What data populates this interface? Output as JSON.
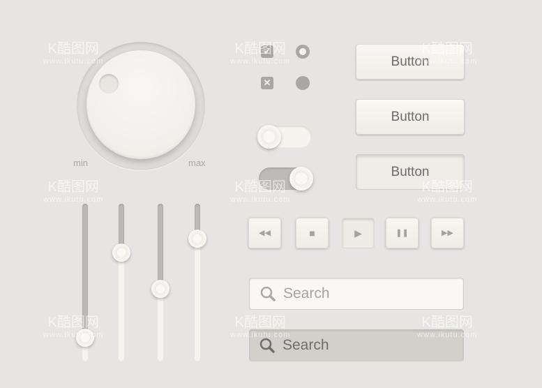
{
  "knob": {
    "min_label": "min",
    "max_label": "max"
  },
  "sliders": [
    {
      "value": 0.15
    },
    {
      "value": 0.69
    },
    {
      "value": 0.46
    },
    {
      "value": 0.78
    }
  ],
  "checkboxes": [
    {
      "state": "checked",
      "icon": "check-icon"
    },
    {
      "state": "unchecked",
      "icon": "x-icon",
      "glyph": "✕"
    }
  ],
  "radios": [
    {
      "selected": true
    },
    {
      "selected": false
    }
  ],
  "toggles": [
    {
      "on": false
    },
    {
      "on": true
    }
  ],
  "buttons": [
    {
      "label": "Button",
      "state": "normal"
    },
    {
      "label": "Button",
      "state": "normal"
    },
    {
      "label": "Button",
      "state": "pressed"
    }
  ],
  "media": [
    {
      "icon": "rewind-icon",
      "glyph": "◀◀"
    },
    {
      "icon": "stop-icon",
      "glyph": "■"
    },
    {
      "icon": "play-icon",
      "glyph": "▶",
      "pressed": true
    },
    {
      "icon": "pause-icon",
      "glyph": "❚❚"
    },
    {
      "icon": "fast-forward-icon",
      "glyph": "▶▶"
    }
  ],
  "search": [
    {
      "placeholder": "Search",
      "style": "light"
    },
    {
      "placeholder": "Search",
      "style": "dark"
    }
  ],
  "watermark": {
    "brand": "K酷图网",
    "url": "www.ikutu.com"
  }
}
